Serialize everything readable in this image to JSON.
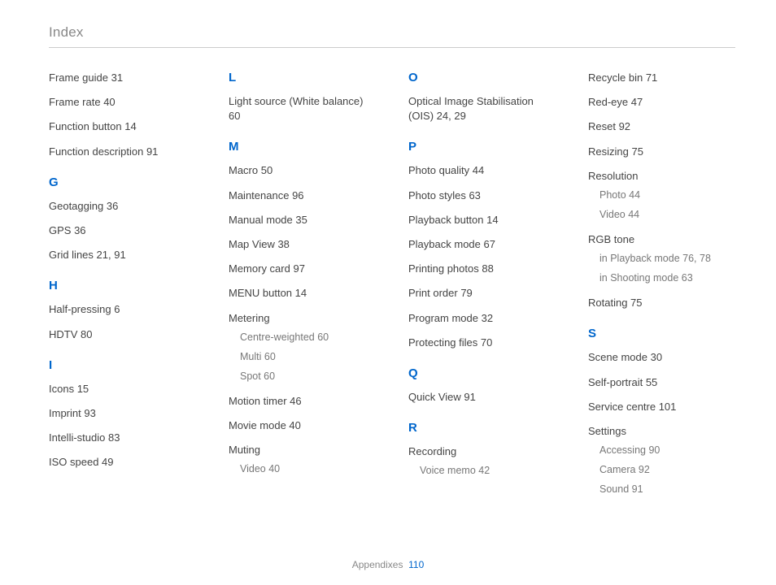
{
  "header": "Index",
  "footer": {
    "section": "Appendixes",
    "page": "110"
  },
  "columns": [
    {
      "blocks": [
        {
          "type": "entry",
          "title": "Frame guide",
          "pages": "31"
        },
        {
          "type": "entry",
          "title": "Frame rate",
          "pages": "40"
        },
        {
          "type": "entry",
          "title": "Function button",
          "pages": "14"
        },
        {
          "type": "entry",
          "title": "Function description",
          "pages": "91"
        },
        {
          "type": "letter",
          "text": "G"
        },
        {
          "type": "entry",
          "title": "Geotagging",
          "pages": "36"
        },
        {
          "type": "entry",
          "title": "GPS",
          "pages": "36"
        },
        {
          "type": "entry",
          "title": "Grid lines",
          "pages": "21, 91"
        },
        {
          "type": "letter",
          "text": "H"
        },
        {
          "type": "entry",
          "title": "Half-pressing",
          "pages": "6"
        },
        {
          "type": "entry",
          "title": "HDTV",
          "pages": "80"
        },
        {
          "type": "letter",
          "text": "I"
        },
        {
          "type": "entry",
          "title": "Icons",
          "pages": "15"
        },
        {
          "type": "entry",
          "title": "Imprint",
          "pages": "93"
        },
        {
          "type": "entry",
          "title": "Intelli-studio",
          "pages": "83"
        },
        {
          "type": "entry",
          "title": "ISO speed",
          "pages": "49"
        }
      ]
    },
    {
      "blocks": [
        {
          "type": "letter",
          "text": "L"
        },
        {
          "type": "entry",
          "title": "Light source (White balance)",
          "pages": "60"
        },
        {
          "type": "letter",
          "text": "M"
        },
        {
          "type": "entry",
          "title": "Macro",
          "pages": "50"
        },
        {
          "type": "entry",
          "title": "Maintenance",
          "pages": "96"
        },
        {
          "type": "entry",
          "title": "Manual mode",
          "pages": "35"
        },
        {
          "type": "entry",
          "title": "Map View",
          "pages": "38"
        },
        {
          "type": "entry",
          "title": "Memory card",
          "pages": "97"
        },
        {
          "type": "entry",
          "title": "MENU button",
          "pages": "14"
        },
        {
          "type": "entry",
          "title": "Metering",
          "subs": [
            {
              "title": "Centre-weighted",
              "pages": "60"
            },
            {
              "title": "Multi",
              "pages": "60"
            },
            {
              "title": "Spot",
              "pages": "60"
            }
          ]
        },
        {
          "type": "entry",
          "title": "Motion timer",
          "pages": "46"
        },
        {
          "type": "entry",
          "title": "Movie mode",
          "pages": "40"
        },
        {
          "type": "entry",
          "title": "Muting",
          "subs": [
            {
              "title": "Video",
              "pages": "40"
            }
          ]
        }
      ]
    },
    {
      "blocks": [
        {
          "type": "letter",
          "text": "O"
        },
        {
          "type": "entry",
          "title": "Optical Image Stabilisation (OIS)",
          "pages": "24, 29"
        },
        {
          "type": "letter",
          "text": "P"
        },
        {
          "type": "entry",
          "title": "Photo quality",
          "pages": "44"
        },
        {
          "type": "entry",
          "title": "Photo styles",
          "pages": "63"
        },
        {
          "type": "entry",
          "title": "Playback button",
          "pages": "14"
        },
        {
          "type": "entry",
          "title": "Playback mode",
          "pages": "67"
        },
        {
          "type": "entry",
          "title": "Printing photos",
          "pages": "88"
        },
        {
          "type": "entry",
          "title": "Print order",
          "pages": "79"
        },
        {
          "type": "entry",
          "title": "Program mode",
          "pages": "32"
        },
        {
          "type": "entry",
          "title": "Protecting files",
          "pages": "70"
        },
        {
          "type": "letter",
          "text": "Q"
        },
        {
          "type": "entry",
          "title": "Quick View",
          "pages": "91"
        },
        {
          "type": "letter",
          "text": "R"
        },
        {
          "type": "entry",
          "title": "Recording",
          "subs": [
            {
              "title": "Voice memo",
              "pages": "42"
            }
          ]
        }
      ]
    },
    {
      "blocks": [
        {
          "type": "entry",
          "title": "Recycle bin",
          "pages": "71"
        },
        {
          "type": "entry",
          "title": "Red-eye",
          "pages": "47"
        },
        {
          "type": "entry",
          "title": "Reset",
          "pages": "92"
        },
        {
          "type": "entry",
          "title": "Resizing",
          "pages": "75"
        },
        {
          "type": "entry",
          "title": "Resolution",
          "subs": [
            {
              "title": "Photo",
              "pages": "44"
            },
            {
              "title": "Video",
              "pages": "44"
            }
          ]
        },
        {
          "type": "entry",
          "title": "RGB tone",
          "subs": [
            {
              "title": "in Playback mode",
              "pages": "76, 78"
            },
            {
              "title": "in Shooting mode",
              "pages": "63"
            }
          ]
        },
        {
          "type": "entry",
          "title": "Rotating",
          "pages": "75"
        },
        {
          "type": "letter",
          "text": "S"
        },
        {
          "type": "entry",
          "title": "Scene mode",
          "pages": "30"
        },
        {
          "type": "entry",
          "title": "Self-portrait",
          "pages": "55"
        },
        {
          "type": "entry",
          "title": "Service centre",
          "pages": "101"
        },
        {
          "type": "entry",
          "title": "Settings",
          "subs": [
            {
              "title": "Accessing",
              "pages": "90"
            },
            {
              "title": "Camera",
              "pages": "92"
            },
            {
              "title": "Sound",
              "pages": "91"
            }
          ]
        }
      ]
    }
  ]
}
